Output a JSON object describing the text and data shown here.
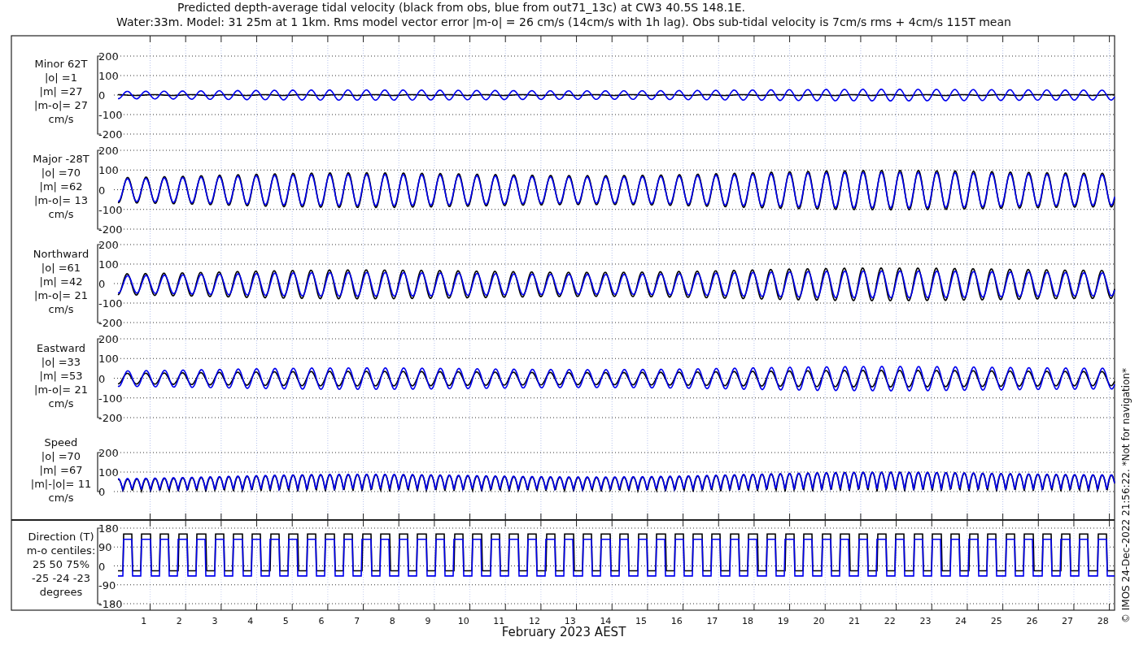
{
  "title": [
    "Predicted depth-average tidal velocity (black from obs, blue from out71_13c) at CW3 40.5S 148.1E.",
    "Water:33m. Model: 31 25m at 1 1km. Rms model vector error |m-o| = 26 cm/s (14cm/s with 1h lag). Obs sub-tidal velocity is 7cm/s rms + 4cm/s 115T mean"
  ],
  "panels": [
    {
      "kind": "wave",
      "label": [
        "Minor 62T",
        "|o| =1",
        "|m| =27",
        "|m-o|= 27",
        "cm/s"
      ],
      "yticks": [
        "200",
        "100",
        "0",
        "-100",
        "-200"
      ]
    },
    {
      "kind": "wave",
      "label": [
        "Major -28T",
        "|o| =70",
        "|m| =62",
        "|m-o|= 13",
        "cm/s"
      ],
      "yticks": [
        "200",
        "100",
        "0",
        "-100",
        "-200"
      ]
    },
    {
      "kind": "wave",
      "label": [
        "Northward",
        "|o| =61",
        "|m| =42",
        "|m-o|= 21",
        "cm/s"
      ],
      "yticks": [
        "200",
        "100",
        "0",
        "-100",
        "-200"
      ]
    },
    {
      "kind": "wave",
      "label": [
        "Eastward",
        "|o| =33",
        "|m| =53",
        "|m-o|= 21",
        "cm/s"
      ],
      "yticks": [
        "200",
        "100",
        "0",
        "-100",
        "-200"
      ]
    },
    {
      "kind": "speed",
      "label": [
        "Speed",
        "|o| =70",
        "|m| =67",
        "|m|-|o|= 11",
        "cm/s"
      ],
      "yticks": [
        "200",
        "100",
        "0"
      ]
    },
    {
      "kind": "direction",
      "label": [
        "Direction (T)",
        "m-o centiles:",
        "25  50  75%",
        "-25 -24 -23",
        "degrees"
      ],
      "yticks": [
        "180",
        "90",
        "0",
        "-90",
        "-180"
      ]
    }
  ],
  "days": [
    "1",
    "2",
    "3",
    "4",
    "5",
    "6",
    "7",
    "8",
    "9",
    "10",
    "11",
    "12",
    "13",
    "14",
    "15",
    "16",
    "17",
    "18",
    "19",
    "20",
    "21",
    "22",
    "23",
    "24",
    "25",
    "26",
    "27",
    "28"
  ],
  "xlabel": "February 2023 AEST",
  "side_note": "© IMOS 24-Dec-2022 21:56:22.  *Not for navigation*"
}
